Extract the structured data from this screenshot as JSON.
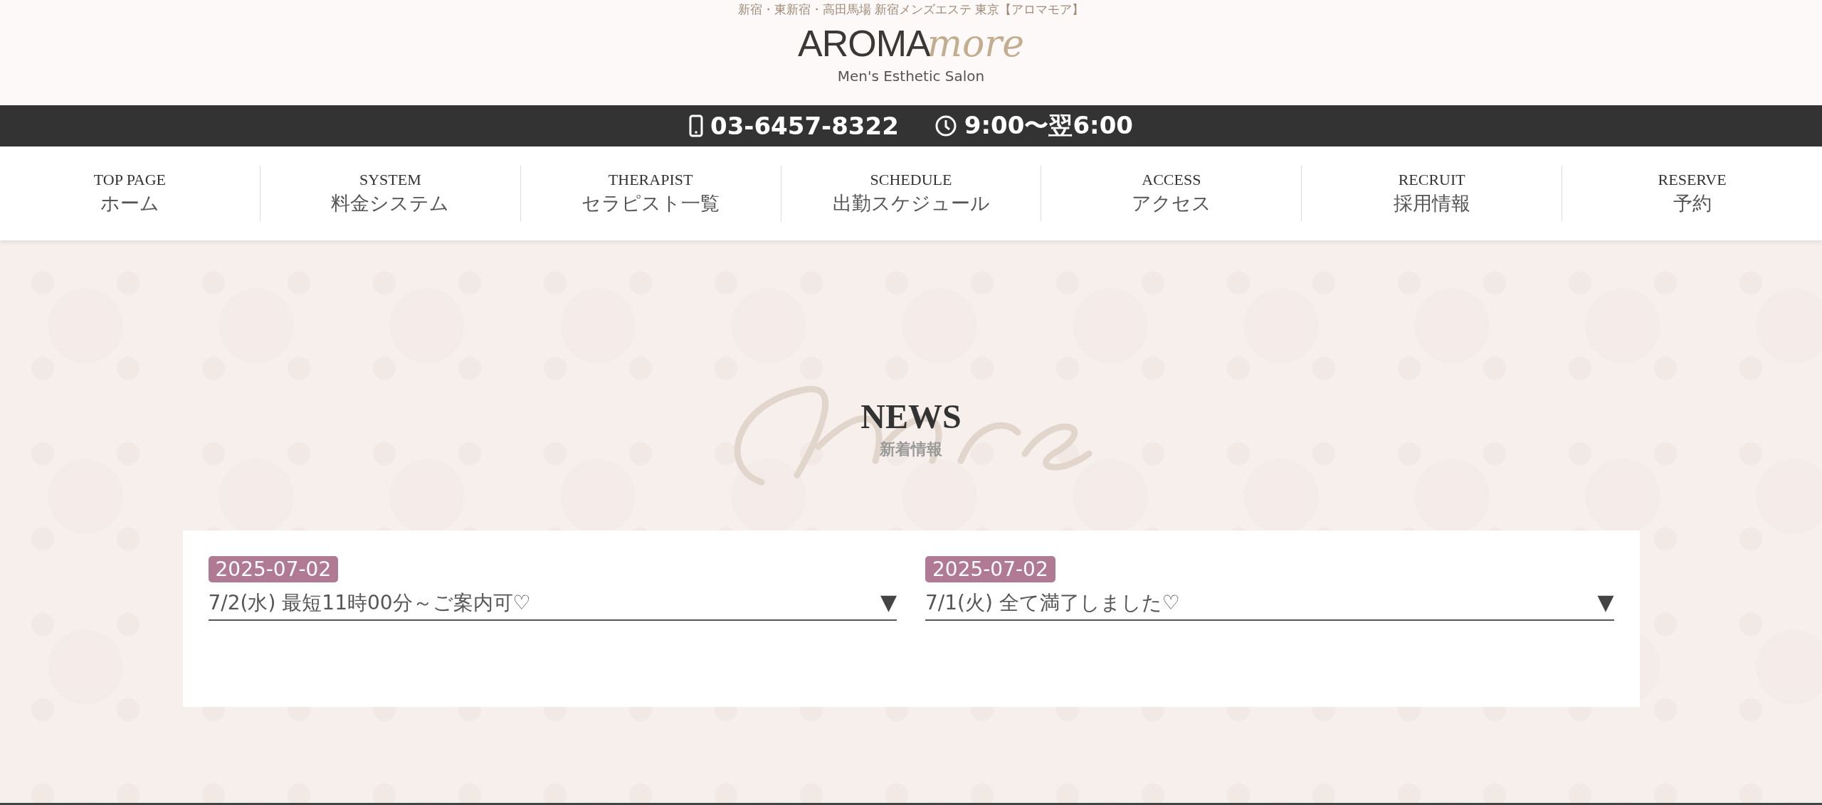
{
  "header": {
    "tagline": "新宿・東新宿・高田馬場 新宿メンズエステ 東京【アロマモア】",
    "logo": {
      "main": "AROMA",
      "script": "more",
      "subtitle": "Men's Esthetic Salon"
    }
  },
  "info_bar": {
    "phone": "03-6457-8322",
    "hours": "9:00〜翌6:00"
  },
  "nav": [
    {
      "en": "TOP PAGE",
      "ja": "ホーム"
    },
    {
      "en": "SYSTEM",
      "ja": "料金システム"
    },
    {
      "en": "THERAPIST",
      "ja": "セラピスト一覧"
    },
    {
      "en": "SCHEDULE",
      "ja": "出勤スケジュール"
    },
    {
      "en": "ACCESS",
      "ja": "アクセス"
    },
    {
      "en": "RECRUIT",
      "ja": "採用情報"
    },
    {
      "en": "RESERVE",
      "ja": "予約"
    }
  ],
  "news": {
    "title": "NEWS",
    "subtitle": "新着情報",
    "items": [
      {
        "date": "2025-07-02",
        "text": "7/2(水) 最短11時00分～ご案内可♡",
        "toggle": "▼"
      },
      {
        "date": "2025-07-02",
        "text": "7/1(火) 全て満了しました♡",
        "toggle": "▼"
      }
    ]
  }
}
